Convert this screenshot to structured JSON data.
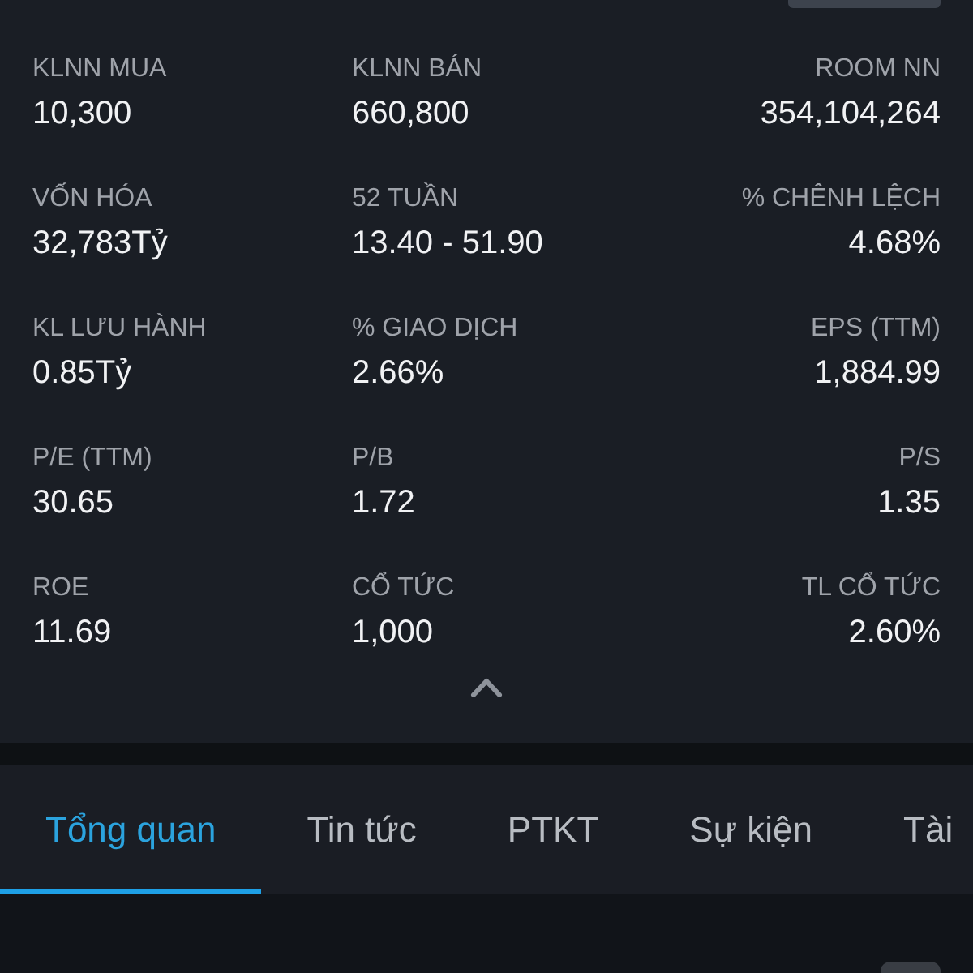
{
  "stats": [
    {
      "label": "KLNN MUA",
      "value": "10,300"
    },
    {
      "label": "KLNN BÁN",
      "value": "660,800"
    },
    {
      "label": "ROOM NN",
      "value": "354,104,264"
    },
    {
      "label": "VỐN HÓA",
      "value": "32,783Tỷ"
    },
    {
      "label": "52 TUẦN",
      "value": "13.40 - 51.90"
    },
    {
      "label": "% CHÊNH LỆCH",
      "value": "4.68%"
    },
    {
      "label": "KL LƯU HÀNH",
      "value": "0.85Tỷ"
    },
    {
      "label": "% GIAO DỊCH",
      "value": "2.66%"
    },
    {
      "label": "EPS (TTM)",
      "value": "1,884.99"
    },
    {
      "label": "P/E (TTM)",
      "value": "30.65"
    },
    {
      "label": "P/B",
      "value": "1.72"
    },
    {
      "label": "P/S",
      "value": "1.35"
    },
    {
      "label": "ROE",
      "value": "11.69"
    },
    {
      "label": "CỔ TỨC",
      "value": "1,000"
    },
    {
      "label": "TL CỔ TỨC",
      "value": "2.60%"
    }
  ],
  "tabs": [
    {
      "label": "Tổng quan",
      "selected": true
    },
    {
      "label": "Tin tức",
      "selected": false
    },
    {
      "label": "PTKT",
      "selected": false
    },
    {
      "label": "Sự kiện",
      "selected": false
    },
    {
      "label": "Tài",
      "selected": false
    }
  ]
}
